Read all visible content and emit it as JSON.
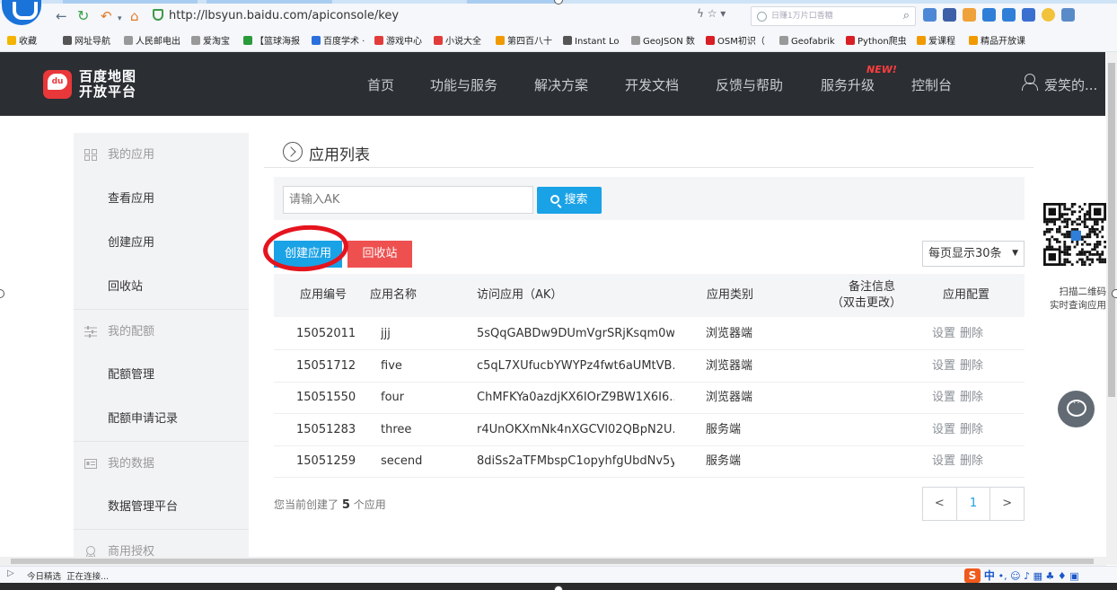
{
  "browser": {
    "url": "http://lbsyun.baidu.com/apiconsole/key",
    "search_placeholder": "日赚1万片口香糖",
    "right_glyphs": "ϟ ☆ ▾"
  },
  "bookmarks": [
    {
      "label": "收藏",
      "color": "#f3b400"
    },
    {
      "label": "网址导航",
      "color": "#555555"
    },
    {
      "label": "人民邮电出",
      "color": "#999999"
    },
    {
      "label": "爱淘宝",
      "color": "#999999"
    },
    {
      "label": "【篮球海报",
      "color": "#2a9a3a"
    },
    {
      "label": "百度学术 ·",
      "color": "#2a6fdb"
    },
    {
      "label": "游戏中心",
      "color": "#e23b3b"
    },
    {
      "label": "小说大全",
      "color": "#e23b3b"
    },
    {
      "label": "第四百八十",
      "color": "#f09a00"
    },
    {
      "label": "Instant Lo",
      "color": "#555555"
    },
    {
      "label": "GeoJSON 数",
      "color": "#999999"
    },
    {
      "label": "OSM初识（",
      "color": "#d81f26"
    },
    {
      "label": "Geofabrik",
      "color": "#999999"
    },
    {
      "label": "Python爬虫",
      "color": "#d81f26"
    },
    {
      "label": "爱课程",
      "color": "#f09a00"
    },
    {
      "label": "精品开放课",
      "color": "#f09a00"
    }
  ],
  "header": {
    "logo_line1": "百度地图",
    "logo_line2": "开放平台",
    "nav": [
      "首页",
      "功能与服务",
      "解决方案",
      "开发文档",
      "反馈与帮助",
      "服务升级",
      "控制台"
    ],
    "new_badge": "NEW!",
    "user_name": "爱笑的..."
  },
  "sidebar": {
    "groups": [
      {
        "label": "我的应用",
        "items": [
          "查看应用",
          "创建应用",
          "回收站"
        ]
      },
      {
        "label": "我的配额",
        "items": [
          "配额管理",
          "配额申请记录"
        ]
      },
      {
        "label": "我的数据",
        "items": [
          "数据管理平台"
        ]
      },
      {
        "label": "商用授权",
        "items": []
      }
    ]
  },
  "main": {
    "title": "应用列表",
    "search_placeholder": "请输入AK",
    "search_button": "搜索",
    "create_button": "创建应用",
    "recycle_button": "回收站",
    "per_page": "每页显示30条"
  },
  "table": {
    "headers": [
      "应用编号",
      "应用名称",
      "访问应用（AK）",
      "应用类别",
      "备注信息",
      "（双击更改）",
      "应用配置"
    ],
    "rows": [
      {
        "id": "15052011",
        "name": "jjj",
        "ak": "5sQqGABDw9DUmVgrSRjKsqm0w...",
        "type": "浏览器端",
        "note": "",
        "op1": "设置",
        "op2": "删除"
      },
      {
        "id": "15051712",
        "name": "five",
        "ak": "c5qL7XUfucbYWYPz4fwt6aUMtVB...",
        "type": "浏览器端",
        "note": "",
        "op1": "设置",
        "op2": "删除"
      },
      {
        "id": "15051550",
        "name": "four",
        "ak": "ChMFKYa0azdjKX6IOrZ9BW1X6I6...",
        "type": "浏览器端",
        "note": "",
        "op1": "设置",
        "op2": "删除"
      },
      {
        "id": "15051283",
        "name": "three",
        "ak": "r4UnOKXmNk4nXGCVl02QBpN2U...",
        "type": "服务端",
        "note": "",
        "op1": "设置",
        "op2": "删除"
      },
      {
        "id": "15051259",
        "name": "secend",
        "ak": "8diSs2aTFMbspC1opyhfgUbdNv5y...",
        "type": "服务端",
        "note": "",
        "op1": "设置",
        "op2": "删除"
      }
    ]
  },
  "summary": {
    "prefix": "您当前创建了",
    "count": "5",
    "suffix": "个应用"
  },
  "pager": {
    "prev": "<",
    "current": "1",
    "next": ">"
  },
  "qr": {
    "line1": "扫描二维码",
    "line2": "实时查询应用"
  },
  "status": {
    "left": "今日精选",
    "loading": "正在连接..."
  },
  "ime": {
    "label": "中"
  },
  "colors": {
    "header_bg": "#2b2e33",
    "accent_blue": "#1aa2e6",
    "danger_red": "#ee5050",
    "annotation_red": "#e5141e"
  },
  "icons": {
    "back": "arrow-left-icon",
    "forward": "arrow-right-icon",
    "reload": "reload-icon",
    "undo": "undo-icon",
    "home": "home-icon",
    "shield": "shield-icon",
    "user": "user-icon",
    "chat": "chat-icon",
    "search": "search-icon"
  }
}
